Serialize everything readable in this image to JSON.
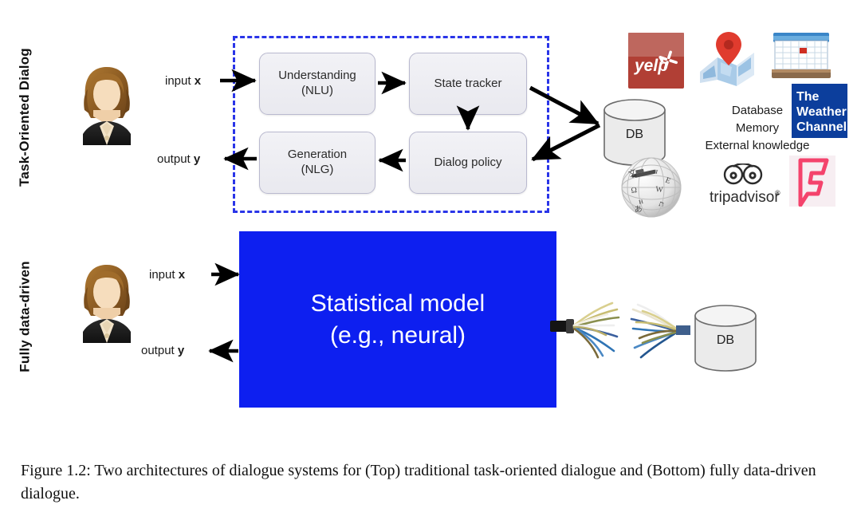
{
  "figure": {
    "row_labels": {
      "top": "Task-Oriented Dialog",
      "bottom": "Fully data-driven"
    },
    "top_system": {
      "io": {
        "input_prefix": "input ",
        "input_symbol": "x",
        "output_prefix": "output ",
        "output_symbol": "y"
      },
      "modules": [
        {
          "id": "nlu",
          "line1": "Understanding",
          "line2": "(NLU)"
        },
        {
          "id": "state_tracker",
          "line1": "State tracker",
          "line2": ""
        },
        {
          "id": "nlg",
          "line1": "Generation",
          "line2": "(NLG)"
        },
        {
          "id": "dialog_policy",
          "line1": "Dialog policy",
          "line2": ""
        }
      ],
      "database_label": "DB",
      "knowledge_sources": {
        "line1": "Database",
        "line2": "Memory",
        "line3": "External knowledge"
      },
      "logos": [
        {
          "name": "yelp-logo",
          "text": "yelp",
          "color": "#af3a31"
        },
        {
          "name": "google-maps-logo",
          "text": "",
          "color": "#d93025"
        },
        {
          "name": "calendar-icon",
          "text": "",
          "color": "#2f6fb5"
        },
        {
          "name": "the-weather-channel-logo",
          "text": "The Weather Channel",
          "color": "#0b3d91"
        },
        {
          "name": "wikipedia-logo",
          "text": "",
          "color": "#9a9a9a"
        },
        {
          "name": "tripadvisor-logo",
          "text": "tripadvisor",
          "superscript": "®",
          "color": "#333333"
        },
        {
          "name": "foursquare-logo",
          "text": "",
          "color": "#f4436c"
        }
      ]
    },
    "bottom_system": {
      "io": {
        "input_prefix": "input ",
        "input_symbol": "x",
        "output_prefix": "output ",
        "output_symbol": "y"
      },
      "model": {
        "line1": "Statistical model",
        "line2": "(e.g., neural)",
        "color": "#0d1ff0"
      },
      "database_label": "DB"
    },
    "colors": {
      "dashed_border": "#2a35e8",
      "model_blue": "#0d1ff0",
      "module_fill": "#eeeef3",
      "arrow": "#000000"
    },
    "caption": "Figure 1.2: Two architectures of dialogue systems for (Top) traditional task-oriented dialogue and (Bottom) fully data-driven dialogue."
  }
}
